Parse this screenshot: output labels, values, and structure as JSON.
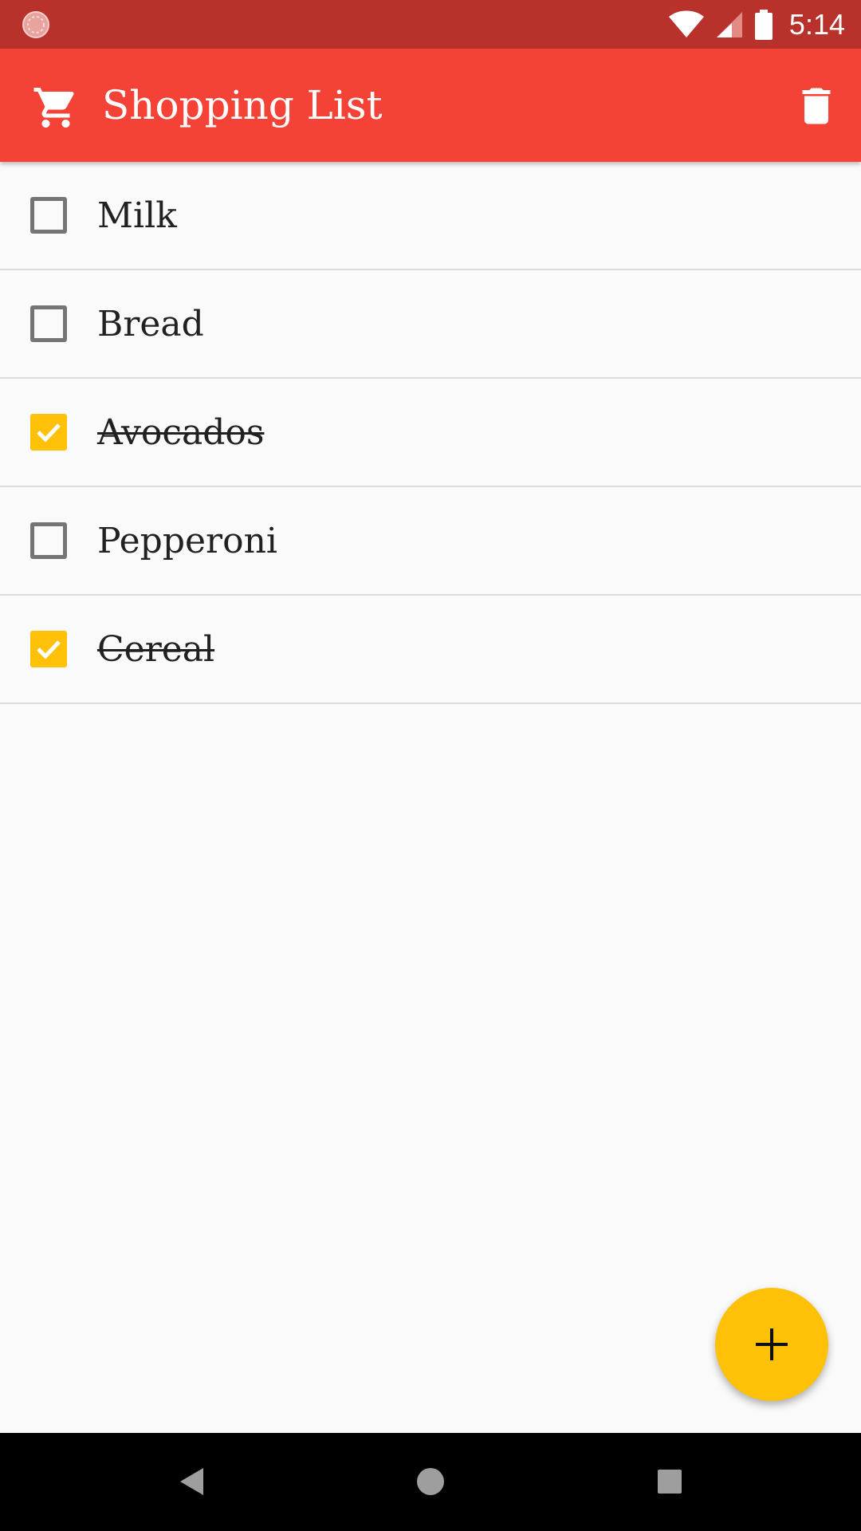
{
  "status_bar": {
    "time": "5:14"
  },
  "app_bar": {
    "title": "Shopping List",
    "icon": "cart-icon",
    "action_icon": "trash-icon"
  },
  "items": [
    {
      "label": "Milk",
      "checked": false
    },
    {
      "label": "Bread",
      "checked": false
    },
    {
      "label": "Avocados",
      "checked": true
    },
    {
      "label": "Pepperoni",
      "checked": false
    },
    {
      "label": "Cereal",
      "checked": true
    }
  ],
  "fab": {
    "icon": "plus-icon"
  },
  "colors": {
    "status_bar": "#b8312b",
    "app_bar": "#f44336",
    "accent": "#ffc107",
    "background": "#fafafa"
  }
}
